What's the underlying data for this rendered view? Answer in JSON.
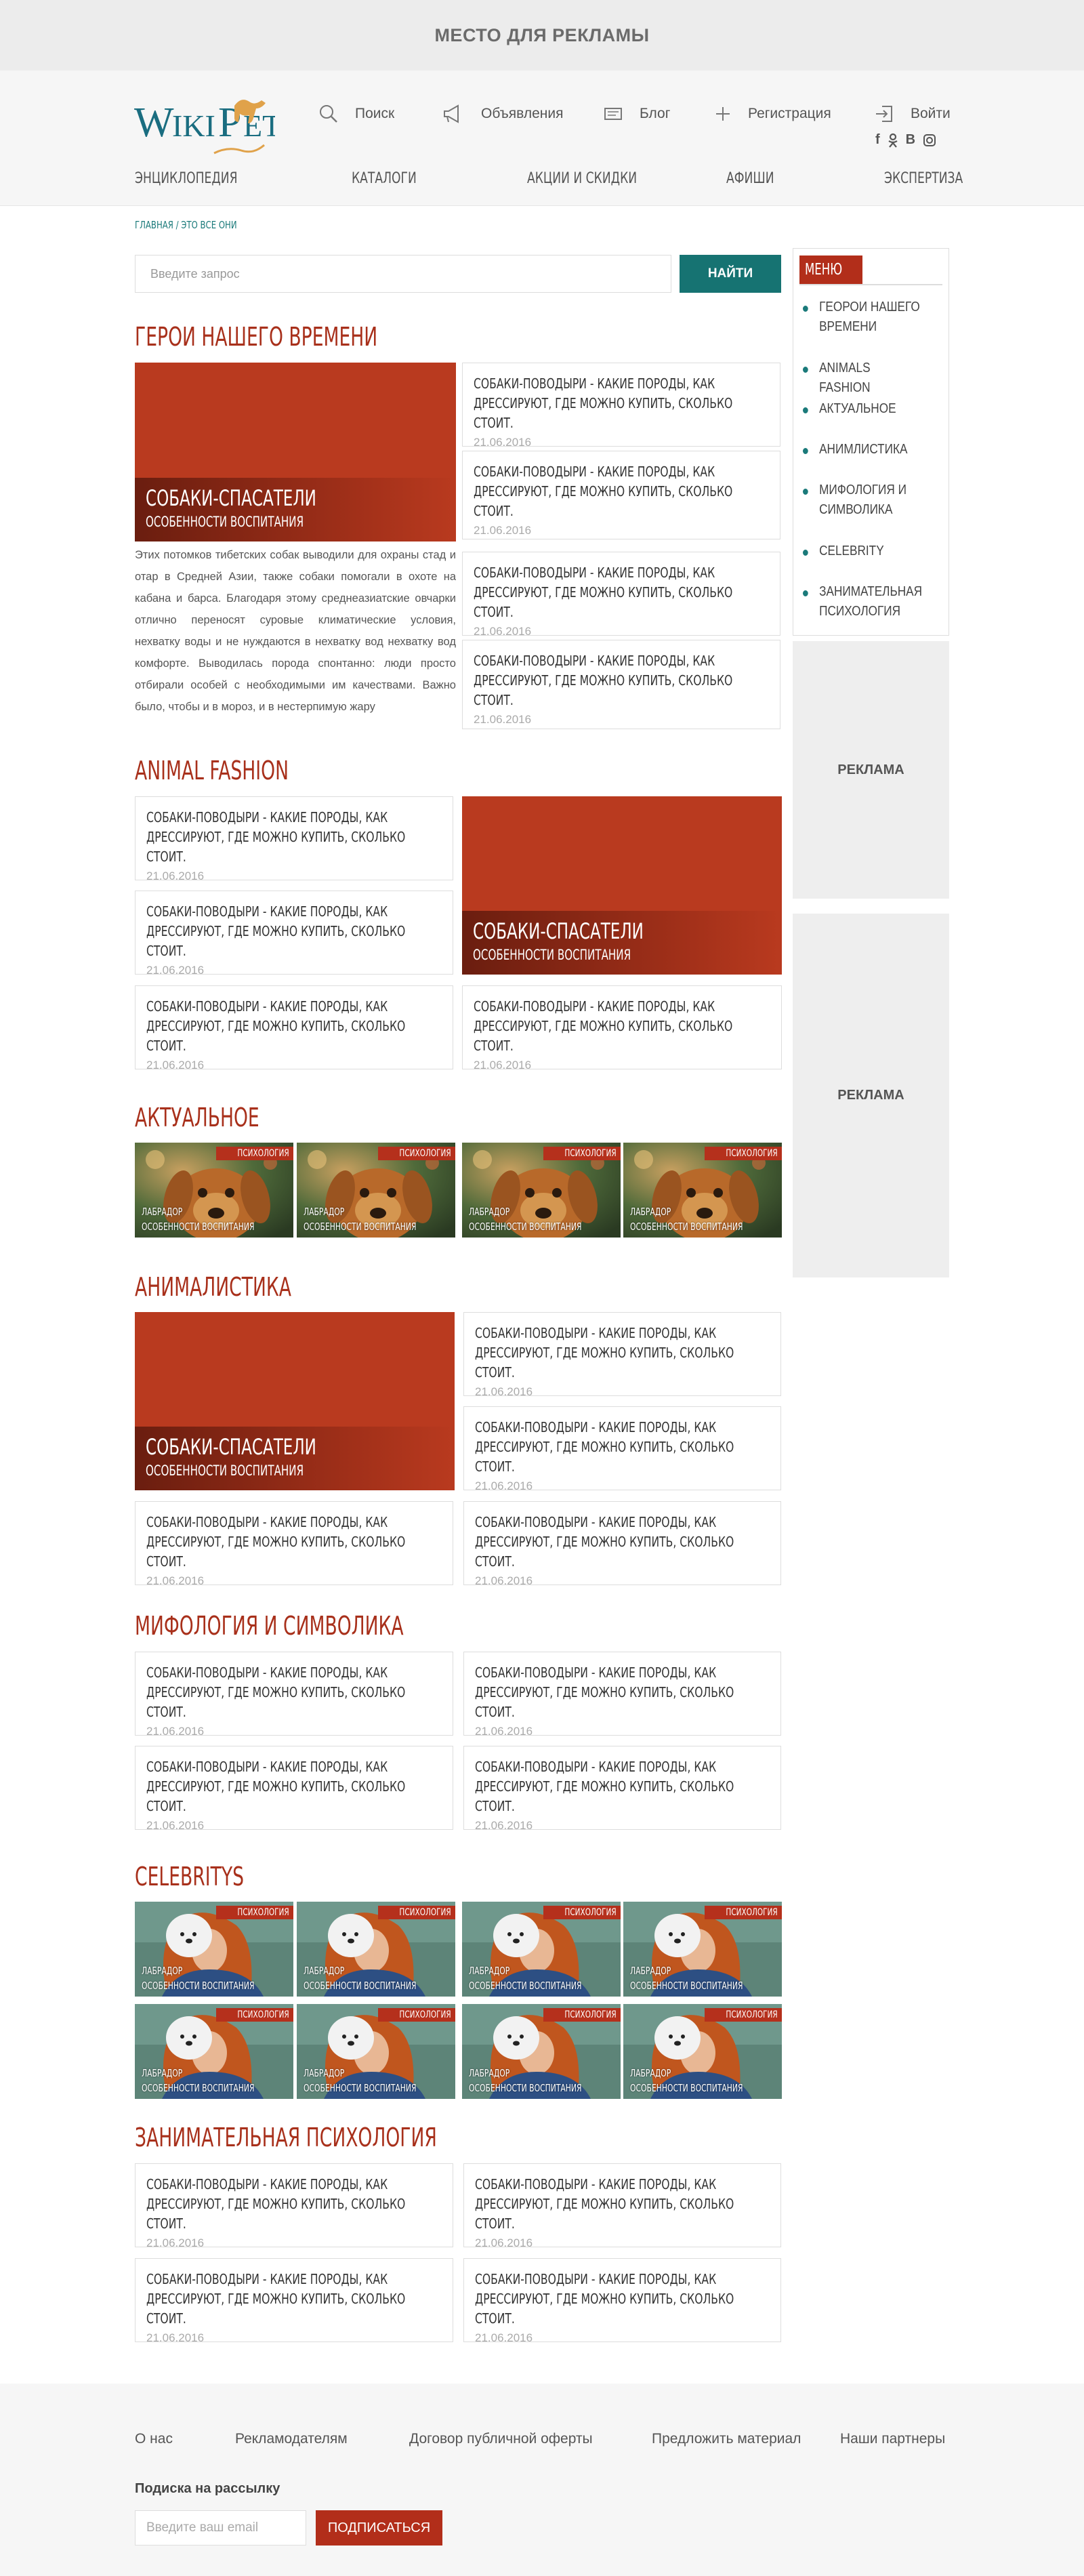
{
  "top_ad": {
    "label": "МЕСТО ДЛЯ РЕКЛАМЫ"
  },
  "header": {
    "logo_text": "WikiPet",
    "links": {
      "search": "Поиск",
      "ads": "Объявления",
      "blog": "Блог",
      "register": "Регистрация",
      "login": "Войти"
    },
    "nav": [
      "ЭНЦИКЛОПЕДИЯ",
      "КАТАЛОГИ",
      "АКЦИИ И СКИДКИ",
      "АФИШИ",
      "ЭКСПЕРТИЗА"
    ],
    "social": [
      "facebook-icon",
      "odnoklassniki-icon",
      "vkontakte-icon",
      "instagram-icon"
    ]
  },
  "breadcrumb": "ГЛАВНАЯ / ЭТО ВСЕ ОНИ",
  "search": {
    "placeholder": "Введите запрос",
    "button": "НАЙТИ"
  },
  "article": {
    "title": "СОБАКИ-ПОВОДЫРИ - КАКИЕ ПОРОДЫ, КАК ДРЕССИРУЮТ, ГДЕ МОЖНО КУПИТЬ, СКОЛЬКО СТОИТ.",
    "date": "21.06.2016"
  },
  "feature": {
    "title": "СОБАКИ-СПАСАТЕЛИ",
    "subtitle": "ОСОБЕННОСТИ ВОСПИТАНИЯ"
  },
  "tile": {
    "badge": "ПСИХОЛОГИЯ",
    "line1": "ЛАБРАДОР",
    "line2": "ОСОБЕННОСТИ ВОСПИТАНИЯ"
  },
  "sections": {
    "heroes": "ГЕРОИ НАШЕГО ВРЕМЕНИ",
    "fashion": "ANIMAL FASHION",
    "actual": "АКТУАЛЬНОЕ",
    "animal": "АНИМАЛИСТИКА",
    "myth": "МИФОЛОГИЯ И СИМВОЛИКА",
    "celeb": "CELEBRITYS",
    "psych": "ЗАНИМАТЕЛЬНАЯ ПСИХОЛОГИЯ"
  },
  "hero_text": "Этих потомков тибетских собак выводили для охраны стад и отар в Средней Азии, также собаки помогали в охоте на кабана и барса. Благодаря этому среднеазиатские овчарки отлично переносят суровые климатические условия, нехватку воды и не нуждаются в нехватку вод нехватку вод комфорте. Выводилась порода спонтанно: люди просто отбирали особей с необходимыми им качествами. Важно было, чтобы и в мороз, и в нестерпимую жару",
  "sidebar": {
    "title": "МЕНЮ",
    "items": [
      "ГЕОРОИ НАШЕГО ВРЕМЕНИ",
      "ANIMALS FASHION",
      "АКТУАЛЬНОЕ",
      "АНИМЛИСТИКА",
      "МИФОЛОГИЯ И СИМВОЛИКА",
      "CELEBRITY",
      "ЗАНИМАТЕЛЬНАЯ ПСИХОЛОГИЯ"
    ],
    "ad1": "РЕКЛАМА",
    "ad2": "РЕКЛАМА"
  },
  "footer": {
    "links": [
      "О нас",
      "Рекламодателям",
      "Договор публичной оферты",
      "Предложить материал",
      "Наши партнеры"
    ],
    "subscribe_title": "Подиска на рассылку",
    "email_placeholder": "Введите ваш email",
    "subscribe_button": "ПОДПИСАТЬСЯ"
  },
  "colors": {
    "accent": "#b22e1a",
    "teal": "#167372"
  }
}
